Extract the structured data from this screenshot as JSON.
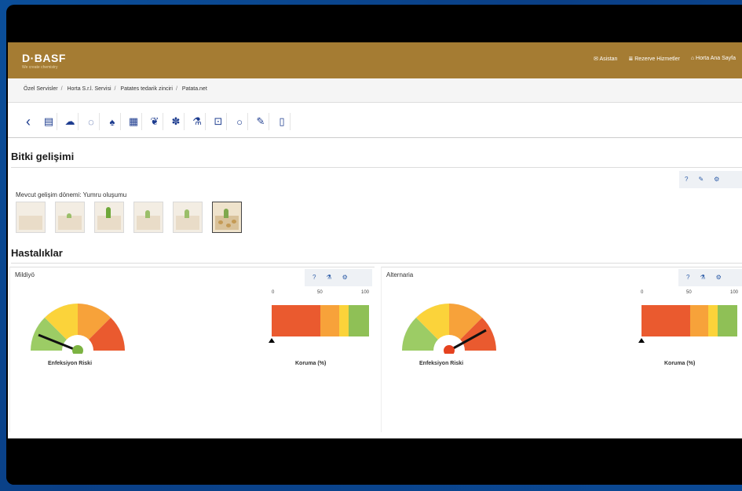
{
  "header": {
    "logo": "D·BASF",
    "logo_sub": "We create chemistry",
    "nav": [
      {
        "icon": "mail-icon",
        "label": "Asistan"
      },
      {
        "icon": "list-icon",
        "label": "Rezerve Hizmetler"
      },
      {
        "icon": "home-icon",
        "label": "Horta Ana Sayfa"
      }
    ]
  },
  "breadcrumb": [
    "Özel Servisler",
    "Horta S.r.l. Servisi",
    "Patates tedarik zinciri",
    "Patata.net"
  ],
  "toolbar": {
    "icons": [
      "back-icon",
      "document-icon",
      "cloud-icon",
      "seed-icon",
      "drop-icon",
      "field-icon",
      "leaf-icon",
      "plant-icon",
      "flask-icon",
      "scan-icon",
      "search-icon",
      "edit-icon",
      "bottle-icon"
    ]
  },
  "growth": {
    "title": "Bitki gelişimi",
    "stage_label": "Mevcut gelişim dönemi: Yumru oluşumu",
    "stages": 6,
    "active_stage": 6
  },
  "diseases": {
    "title": "Hastalıklar",
    "panels": [
      {
        "name": "Mildiyö",
        "gauge_label": "Enfeksiyon Riski",
        "needle_color": "#7cb342",
        "bar_label": "Koruma (%)",
        "ticks": [
          "0",
          "50",
          "100"
        ],
        "marker_value": 0
      },
      {
        "name": "Alternaria",
        "gauge_label": "Enfeksiyon Riski",
        "needle_color": "#e5421f",
        "bar_label": "Koruma (%)",
        "ticks": [
          "0",
          "50",
          "100"
        ],
        "marker_value": 0
      }
    ]
  },
  "colors": {
    "header": "#a57c33",
    "gauge_green": "#9ccc65",
    "gauge_yellow": "#fbd33a",
    "gauge_orange": "#f7a23a",
    "gauge_red": "#ea5a2f"
  }
}
